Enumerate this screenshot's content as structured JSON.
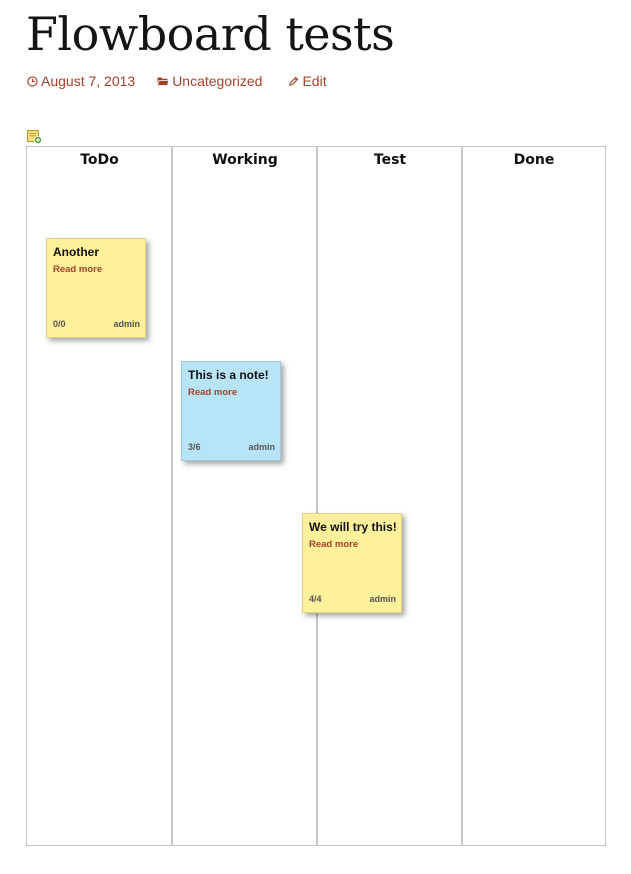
{
  "post": {
    "title": "Flowboard tests",
    "date": "August 7, 2013",
    "category": "Uncategorized",
    "edit_label": "Edit"
  },
  "board": {
    "columns": [
      {
        "label": "ToDo"
      },
      {
        "label": "Working"
      },
      {
        "label": "Test"
      },
      {
        "label": "Done"
      }
    ],
    "notes": [
      {
        "title": "Another",
        "link": "Read more",
        "count": "0/0",
        "author": "admin",
        "color": "#fff09b",
        "column": "ToDo"
      },
      {
        "title": "This is a note!",
        "link": "Read more",
        "count": "3/6",
        "author": "admin",
        "color": "#b8e4f8",
        "column": "Working"
      },
      {
        "title": "We will try this!",
        "link": "Read more",
        "count": "4/4",
        "author": "admin",
        "color": "#fff09b",
        "column": "Test"
      }
    ]
  },
  "colors": {
    "accent": "#a2412c",
    "border": "#c6c6c6",
    "note_yellow": "#fff09b",
    "note_blue": "#b8e4f8"
  },
  "icons": {
    "date": "clock-icon",
    "category": "folder-icon",
    "edit": "pencil-icon",
    "add_note": "add-note-icon"
  }
}
